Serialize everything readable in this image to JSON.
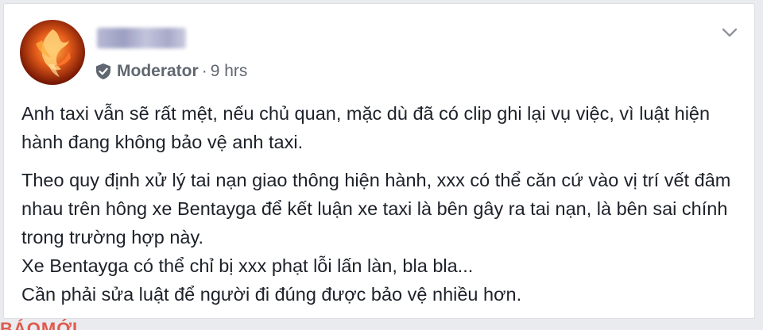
{
  "post": {
    "author_role": "Moderator",
    "separator": "·",
    "timestamp": "9 hrs",
    "paragraph_1": "Anh taxi vẫn sẽ rất mệt, nếu chủ quan, mặc dù đã có clip ghi lại vụ việc, vì luật hiện hành đang không bảo vệ anh taxi.",
    "paragraph_2_lines": [
      "Theo quy định xử lý tai nạn giao thông hiện hành, xxx có thể căn cứ vào vị trí vết đâm nhau trên hông xe Bentayga để kết luận xe taxi là bên gây ra tai nạn, là bên sai chính trong trường hợp này.",
      "Xe Bentayga có thể chỉ bị xxx phạt lỗi lấn làn, bla bla...",
      "Cần phải sửa luật để người đi đúng được bảo vệ nhiều hơn."
    ]
  },
  "watermark_text": "BÁOMỚI",
  "icons": {
    "badge": "shield-check-icon",
    "menu": "chevron-down-icon"
  },
  "colors": {
    "text": "#1d2129",
    "meta": "#616770",
    "background": "#e9ebee"
  }
}
